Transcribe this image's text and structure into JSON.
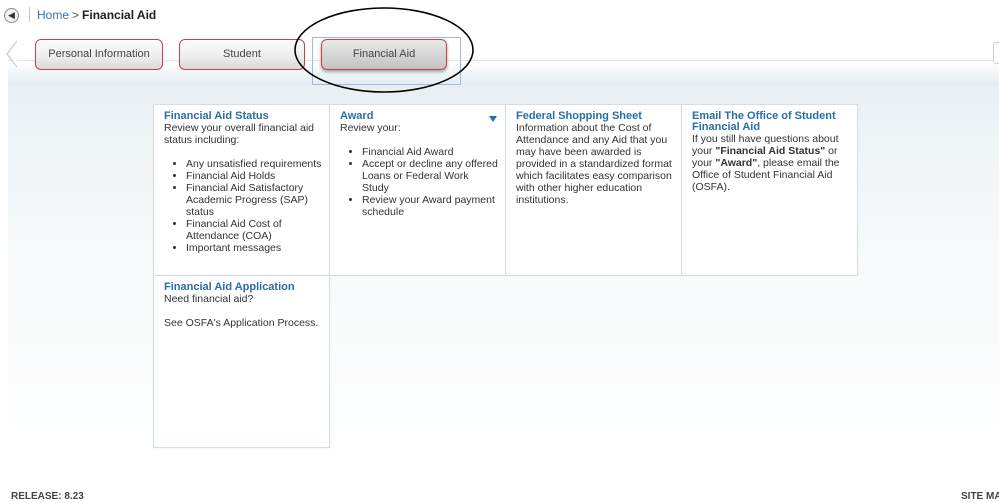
{
  "breadcrumb": {
    "home": "Home",
    "separator": ">",
    "current": "Financial Aid"
  },
  "tabs": [
    {
      "label": "Personal Information"
    },
    {
      "label": "Student"
    },
    {
      "label": "Financial Aid"
    }
  ],
  "cards": {
    "status": {
      "title": "Financial Aid Status",
      "intro": "Review your overall financial aid status including:",
      "items": [
        "Any unsatisfied requirements",
        "Financial Aid Holds",
        "Financial Aid Satisfactory Academic Progress (SAP) status",
        "Financial Aid Cost of Attendance (COA)",
        "Important messages"
      ]
    },
    "award": {
      "title": "Award",
      "intro": "Review your:",
      "items": [
        "Financial Aid Award",
        "Accept or decline any offered Loans or Federal Work Study",
        "Review your Award payment schedule"
      ]
    },
    "shopping": {
      "title": "Federal Shopping Sheet",
      "body": "Information about the Cost of Attendance and any Aid that you may have been awarded is provided in a standardized format which facilitates easy comparison with other higher education institutions."
    },
    "email": {
      "title": "Email The Office of Student Financial Aid",
      "text1": "If you still have questions about your ",
      "strong1": "\"Financial Aid Status\"",
      "text2": " or your ",
      "strong2": "\"Award\"",
      "text3": ", please email the Office of Student Financial Aid (OSFA)."
    },
    "application": {
      "title": "Financial Aid Application",
      "line1": "Need financial aid?",
      "line2": "See OSFA's Application Process."
    }
  },
  "footer": {
    "release": "RELEASE: 8.23",
    "sitemap": "SITE MA"
  },
  "colors": {
    "tab_border": "#c8414a",
    "link_blue": "#2a6fa3",
    "card_border": "#cfe0ea"
  }
}
